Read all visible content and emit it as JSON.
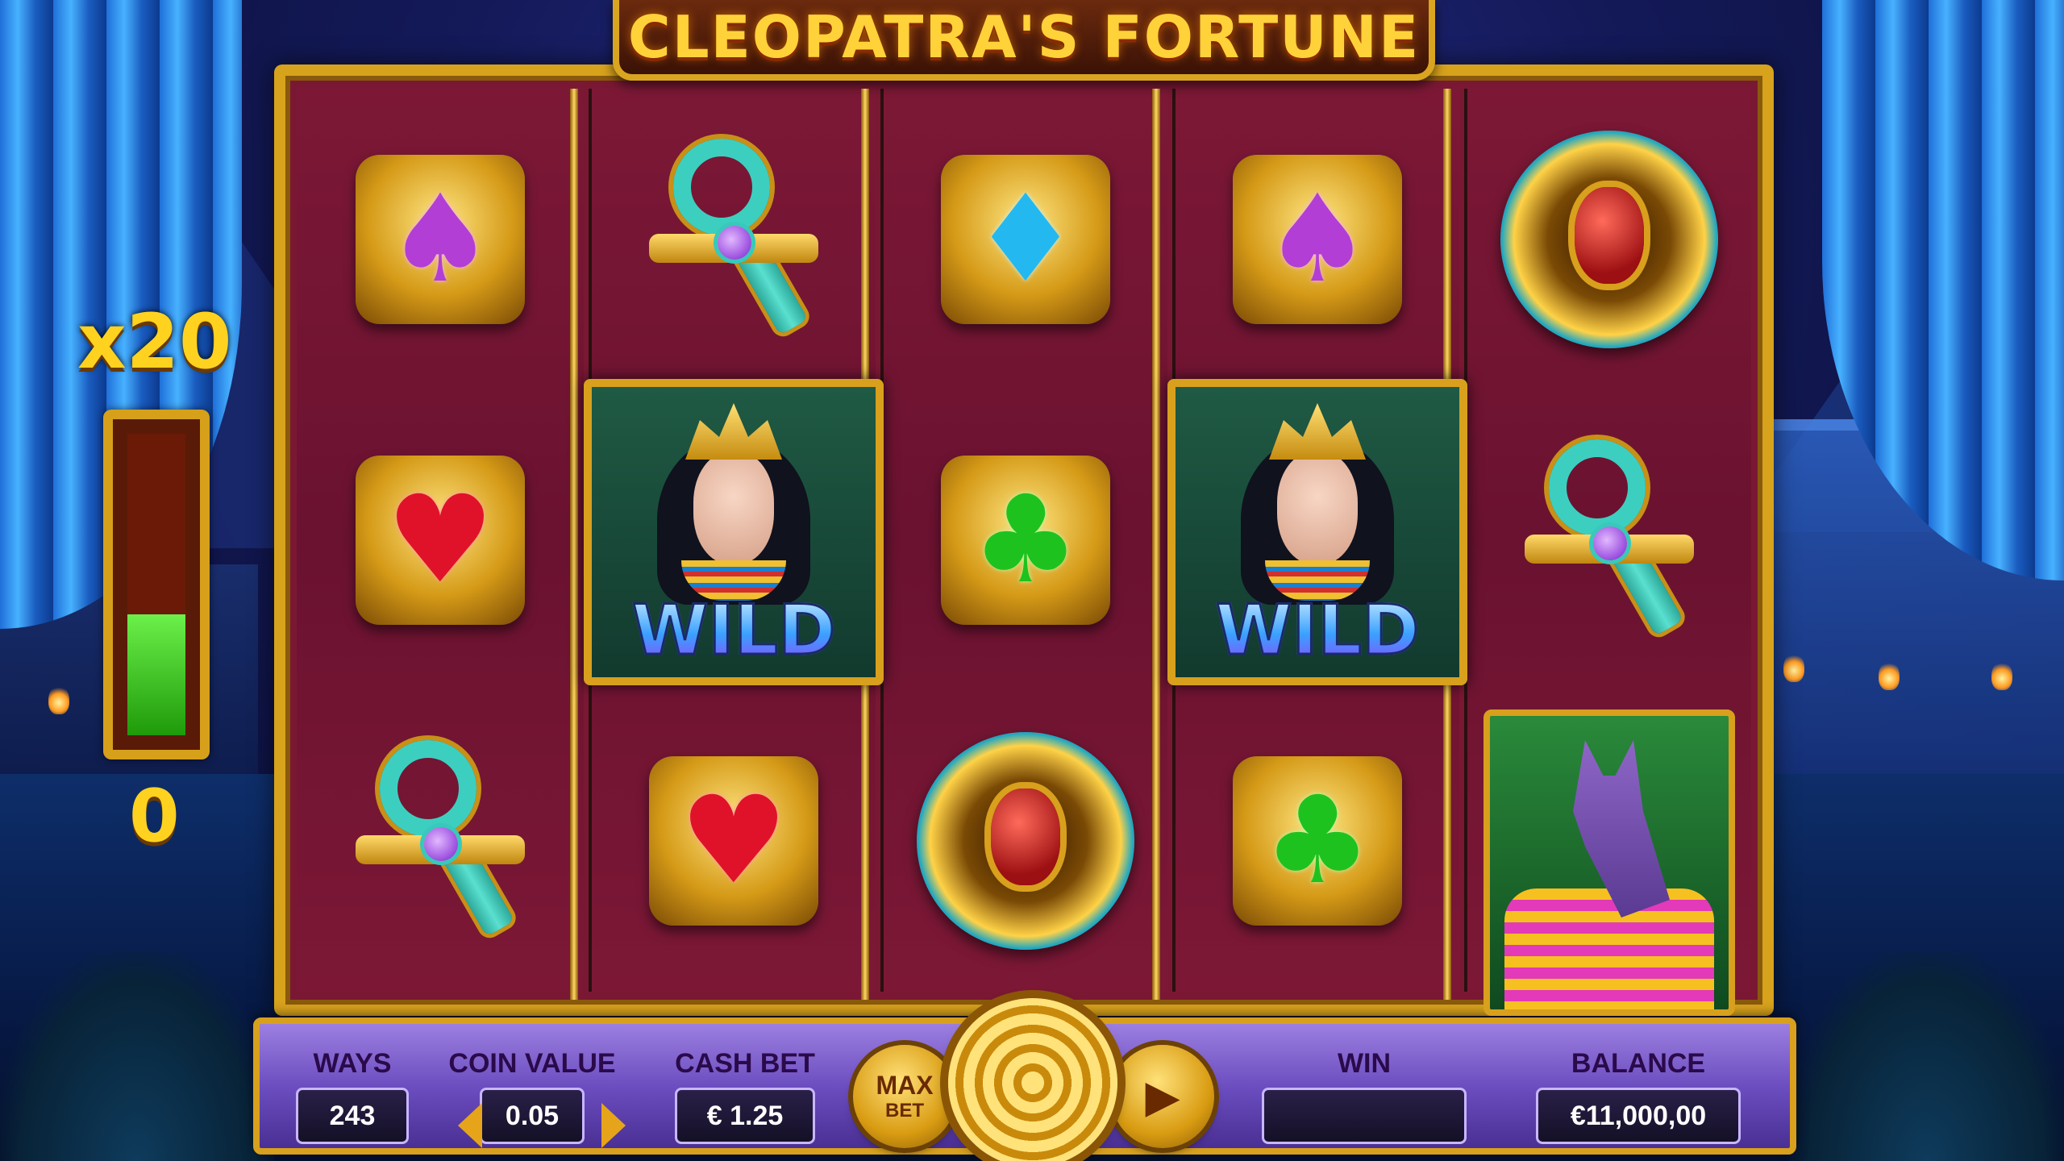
{
  "game": {
    "title": "CLEOPATRA'S FORTUNE"
  },
  "multiplier": {
    "label": "x20",
    "count": "0",
    "meter_fill_fraction": 0.4
  },
  "reels": [
    [
      "purple-spade-gem",
      "red-heart-gem",
      "ankh"
    ],
    [
      "ankh",
      "cleopatra-wild",
      "red-heart-gem"
    ],
    [
      "blue-diamond-gem",
      "green-club-gem",
      "scarab-coin"
    ],
    [
      "purple-spade-gem",
      "cleopatra-wild",
      "green-club-gem"
    ],
    [
      "scarab-coin",
      "ankh",
      "anubis"
    ]
  ],
  "wild_label": "WILD",
  "controls": {
    "ways_label": "WAYS",
    "ways_value": "243",
    "coin_value_label": "COIN VALUE",
    "coin_value": "0.05",
    "cash_bet_label": "CASH BET",
    "cash_bet_value": "€ 1.25",
    "max_bet_line1": "MAX",
    "max_bet_line2": "BET",
    "win_label": "WIN",
    "win_value": "",
    "balance_label": "BALANCE",
    "balance_value": "€11,000,00"
  },
  "icons": {
    "spin": "spiral-spin-icon",
    "autoplay": "autoplay-icon",
    "coin_decrease": "arrow-left-icon",
    "coin_increase": "arrow-right-icon"
  },
  "colors": {
    "frame_gold": "#d8a01c",
    "reel_background": "#7a1834",
    "control_bar_purple": "#6c4ec0",
    "multiplier_yellow": "#ffd21f",
    "meter_green": "#4ad22a"
  }
}
